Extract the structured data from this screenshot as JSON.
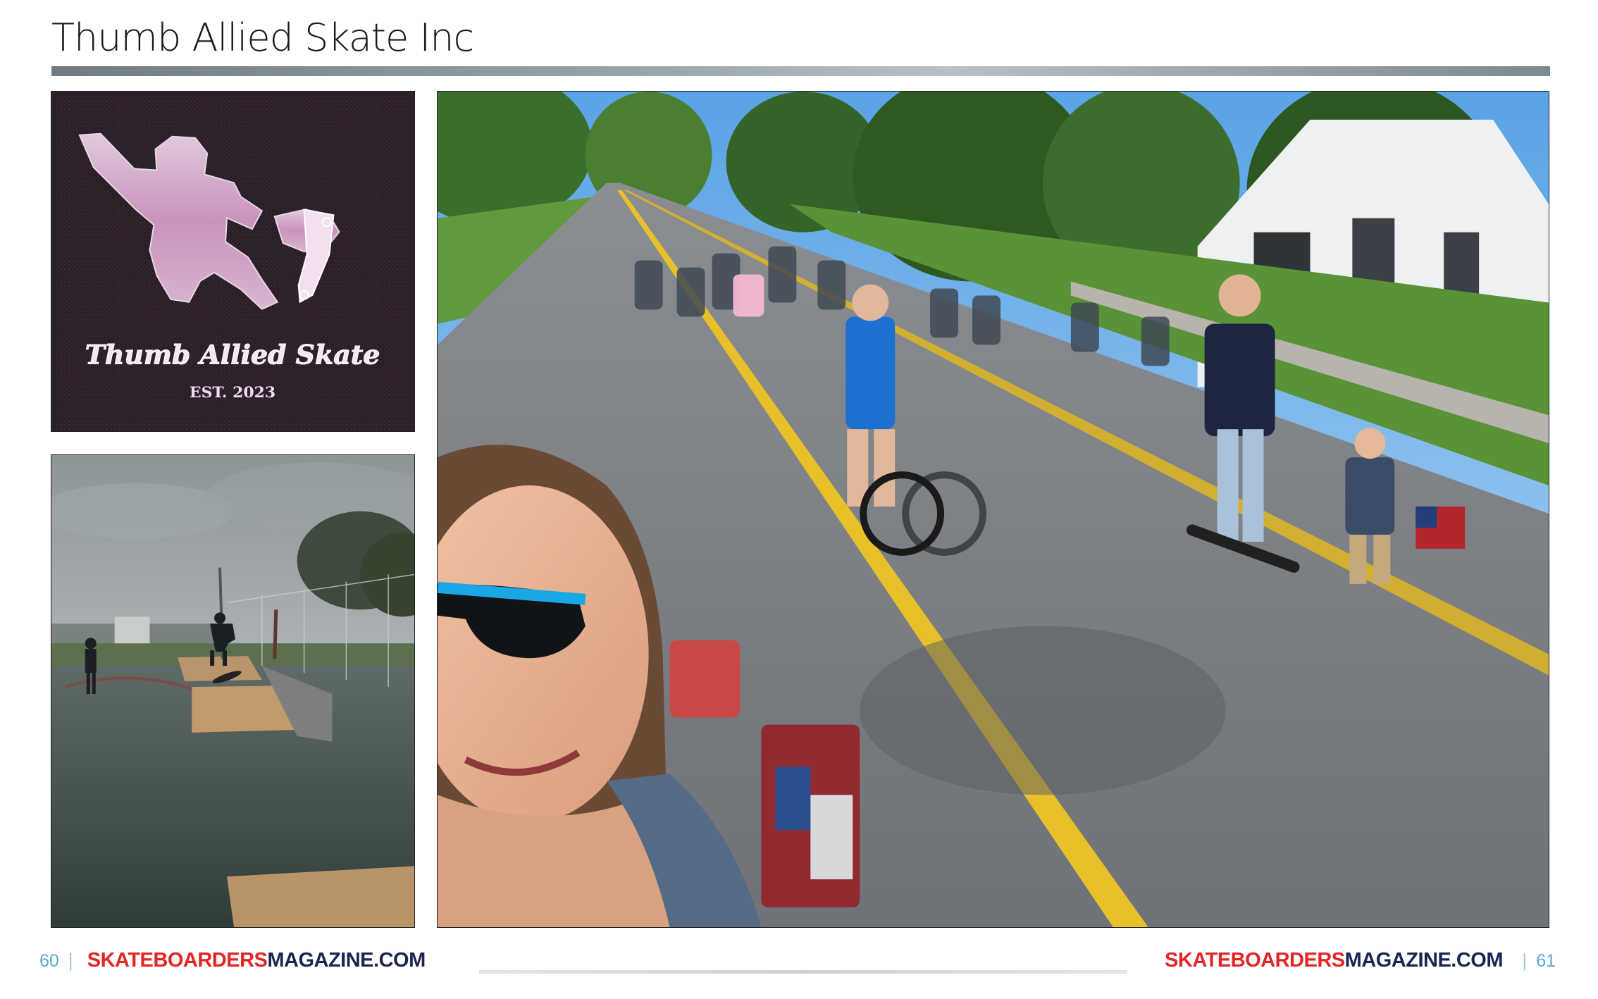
{
  "page": {
    "title": "Thumb Allied Skate Inc"
  },
  "logo": {
    "text": "Thumb Allied Skate",
    "est": "EST. 2023"
  },
  "footer": {
    "left_page": "60",
    "right_page": "61",
    "brand_red": "SKATEBOARDERS",
    "brand_navy": "MAGAZINE.COM"
  },
  "colors": {
    "brand_red": "#e32526",
    "brand_navy": "#1a2551",
    "page_number": "#5ea8d0",
    "title_rule": "#8c979e"
  },
  "photos": [
    {
      "name": "logo-photo",
      "content": "logo"
    },
    {
      "name": "skatepark-photo",
      "content": "photo"
    },
    {
      "name": "parade-photo",
      "content": "photo"
    }
  ]
}
